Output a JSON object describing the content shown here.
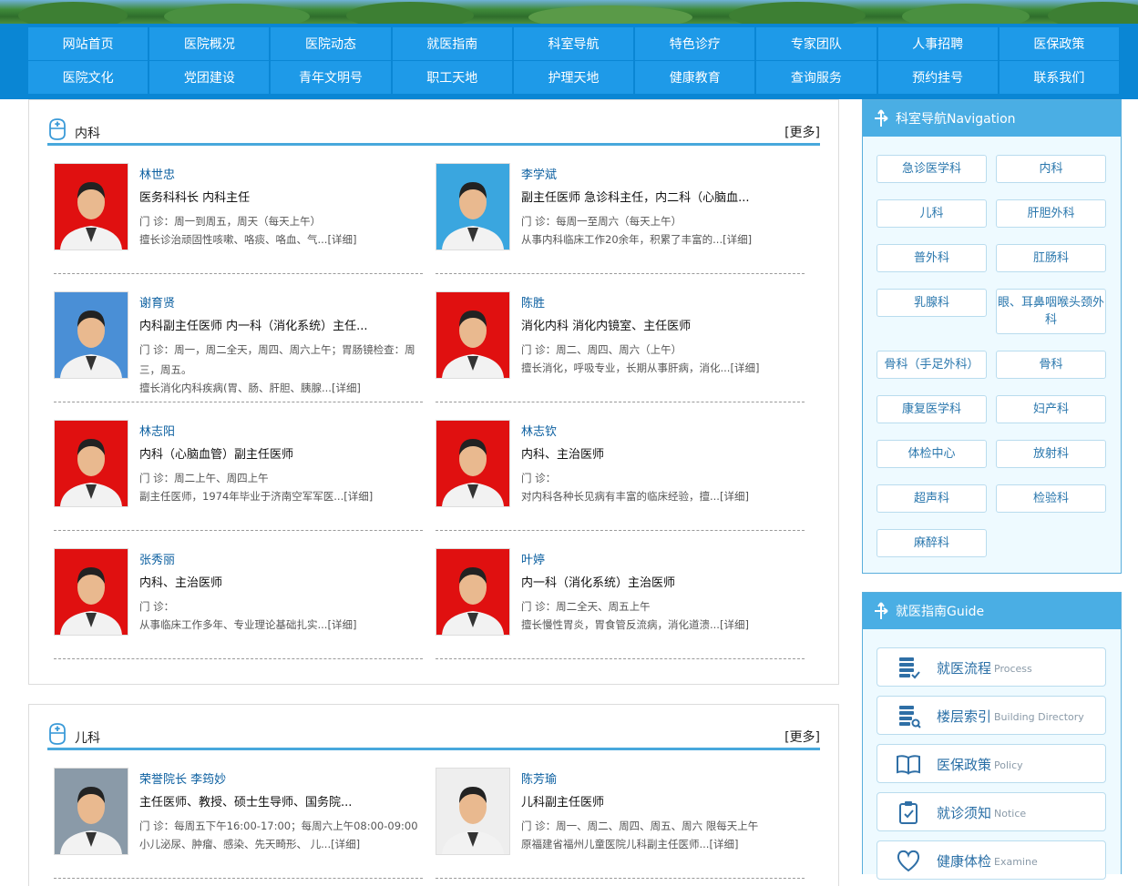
{
  "nav": {
    "row1": [
      "网站首页",
      "医院概况",
      "医院动态",
      "就医指南",
      "科室导航",
      "特色诊疗",
      "专家团队",
      "人事招聘",
      "医保政策"
    ],
    "row2": [
      "医院文化",
      "党团建设",
      "青年文明号",
      "职工天地",
      "护理天地",
      "健康教育",
      "查询服务",
      "预约挂号",
      "联系我们"
    ]
  },
  "internal": {
    "title": "内科",
    "more": "[更多]",
    "doctors": [
      {
        "name": "林世忠",
        "title": "医务科科长 内科主任",
        "clinic": "门 诊：周一到周五，周天（每天上午）",
        "desc": "擅长诊治顽固性咳嗽、咯痰、咯血、气...[详细]",
        "bg": "#e01010"
      },
      {
        "name": "李学斌",
        "title": "副主任医师 急诊科主任，内二科（心脑血...",
        "clinic": "门 诊：每周一至周六（每天上午）",
        "desc": "从事内科临床工作20余年，积累了丰富的...[详细]",
        "bg": "#3aa6df"
      },
      {
        "name": "谢育贤",
        "title": "内科副主任医师 内一科（消化系统）主任...",
        "clinic": "门 诊：周一，周二全天，周四、周六上午；胃肠镜检查：周三，周五。",
        "desc": "擅长消化内科疾病(胃、肠、肝胆、胰腺...[详细]",
        "bg": "#4a8fd6"
      },
      {
        "name": "陈胜",
        "title": "消化内科 消化内镜室、主任医师",
        "clinic": "门 诊：周二、周四、周六（上午）",
        "desc": "擅长消化，呼吸专业，长期从事肝病，消化...[详细]",
        "bg": "#e01010"
      },
      {
        "name": "林志阳",
        "title": "内科（心脑血管）副主任医师",
        "clinic": "门 诊：周二上午、周四上午",
        "desc": "副主任医师，1974年毕业于济南空军军医...[详细]",
        "bg": "#e01010"
      },
      {
        "name": "林志钦",
        "title": "内科、主治医师",
        "clinic": "门 诊：",
        "desc": "对内科各种长见病有丰富的临床经验，擅...[详细]",
        "bg": "#e01010"
      },
      {
        "name": "张秀丽",
        "title": "内科、主治医师",
        "clinic": "门 诊：",
        "desc": "从事临床工作多年、专业理论基础扎实...[详细]",
        "bg": "#e01010"
      },
      {
        "name": "叶婷",
        "title": "内一科（消化系统）主治医师",
        "clinic": "门 诊：周二全天、周五上午",
        "desc": "擅长慢性胃炎，胃食管反流病，消化道溃...[详细]",
        "bg": "#e01010"
      }
    ]
  },
  "pediatrics": {
    "title": "儿科",
    "more": "[更多]",
    "doctors": [
      {
        "name": "荣誉院长 李筠妙",
        "title": "主任医师、教授、硕士生导师、国务院...",
        "clinic": "门 诊：每周五下午16:00-17:00；每周六上午08:00-09:00",
        "desc": "小儿泌尿、肿瘤、感染、先天畸形、 儿...[详细]",
        "bg": "#8a9aa8"
      },
      {
        "name": "陈芳瑜",
        "title": "儿科副主任医师",
        "clinic": "门 诊：周一、周二、周四、周五、周六 限每天上午",
        "desc": "原福建省福州儿童医院儿科副主任医师...[详细]",
        "bg": "#eeeeee"
      }
    ]
  },
  "sidebar_dept": {
    "title": "科室导航Navigation",
    "items": [
      "急诊医学科",
      "内科",
      "儿科",
      "肝胆外科",
      "普外科",
      "肛肠科",
      "乳腺科",
      "眼、耳鼻咽喉头颈外科",
      "骨科（手足外科）",
      "骨科",
      "康复医学科",
      "妇产科",
      "体检中心",
      "放射科",
      "超声科",
      "检验科",
      "麻醉科"
    ]
  },
  "sidebar_guide": {
    "title": "就医指南Guide",
    "items": [
      {
        "label": "就医流程",
        "sub": "Process",
        "icon": "list-check-icon"
      },
      {
        "label": "楼层索引",
        "sub": "Building Directory",
        "icon": "list-search-icon"
      },
      {
        "label": "医保政策",
        "sub": "Policy",
        "icon": "book-icon"
      },
      {
        "label": "就诊须知",
        "sub": "Notice",
        "icon": "clipboard-icon"
      },
      {
        "label": "健康体检",
        "sub": "Examine",
        "icon": "heart-icon"
      }
    ]
  },
  "colors": {
    "nav_bg": "#0a86d4",
    "nav_item": "#1e9ae8",
    "accent": "#48a8dc",
    "link": "#0b5fa0"
  }
}
